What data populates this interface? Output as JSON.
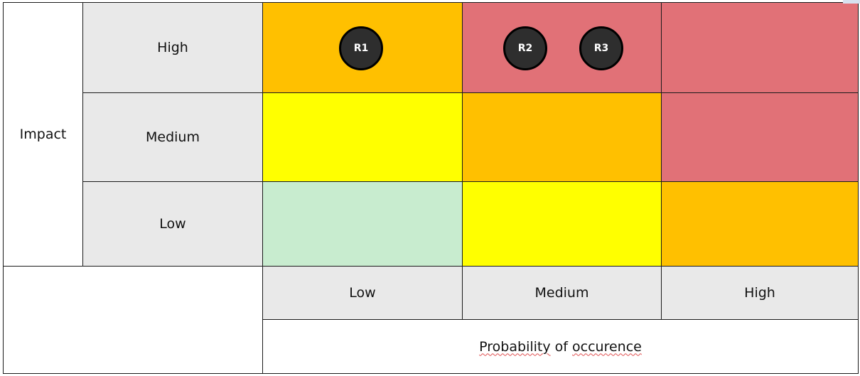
{
  "matrix": {
    "row_axis_label": "Impact",
    "column_axis_label_words": [
      "Probability",
      "of",
      "occurence"
    ],
    "row_labels": [
      "High",
      "Medium",
      "Low"
    ],
    "column_labels": [
      "Low",
      "Medium",
      "High"
    ],
    "cells": [
      [
        {
          "color": "#ffc000",
          "risks": [
            "R1"
          ]
        },
        {
          "color": "#e17177",
          "risks": [
            "R2",
            "R3"
          ]
        },
        {
          "color": "#e17177",
          "risks": []
        }
      ],
      [
        {
          "color": "#ffff00",
          "risks": []
        },
        {
          "color": "#ffc000",
          "risks": []
        },
        {
          "color": "#e17177",
          "risks": []
        }
      ],
      [
        {
          "color": "#c8eccf",
          "risks": []
        },
        {
          "color": "#ffff00",
          "risks": []
        },
        {
          "color": "#ffc000",
          "risks": []
        }
      ]
    ],
    "risk_marker_color": "#2e2e2e"
  }
}
